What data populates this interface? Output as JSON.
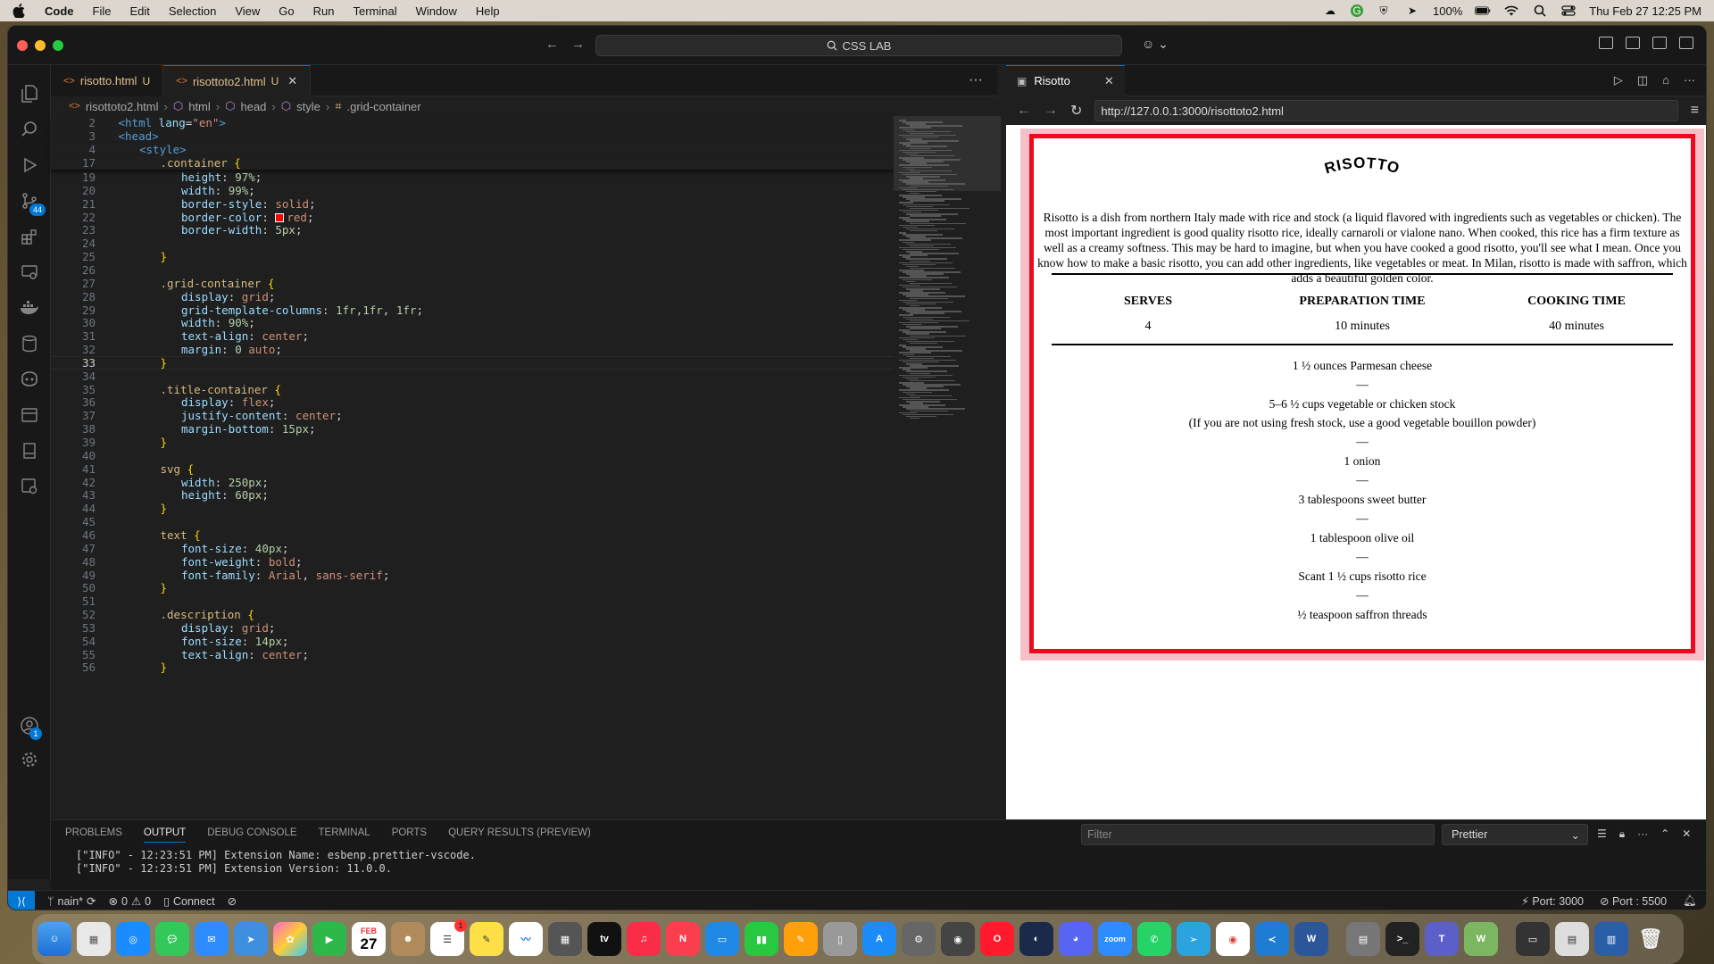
{
  "menubar": {
    "app": "Code",
    "items": [
      "File",
      "Edit",
      "Selection",
      "View",
      "Go",
      "Run",
      "Terminal",
      "Window",
      "Help"
    ],
    "battery": "100%",
    "datetime": "Thu Feb 27  12:25 PM"
  },
  "titlebar": {
    "search": "CSS LAB"
  },
  "activity_badges": {
    "source_control": "44",
    "accounts": "1"
  },
  "editor_tabs": [
    {
      "name": "risotto.html",
      "status": "U"
    },
    {
      "name": "risottoto2.html",
      "status": "U"
    }
  ],
  "breadcrumb": [
    "risottoto2.html",
    "html",
    "head",
    "style",
    ".grid-container"
  ],
  "code": {
    "sticky": [
      {
        "ln": "2",
        "indent": 1,
        "html": "<span class='c-tag'>&lt;html</span> <span class='c-attr'>lang</span>=<span class='c-str'>\"en\"</span><span class='c-tag'>&gt;</span>"
      },
      {
        "ln": "3",
        "indent": 1,
        "html": "<span class='c-tag'>&lt;head&gt;</span>"
      },
      {
        "ln": "4",
        "indent": 2,
        "html": "<span class='c-tag'>&lt;style&gt;</span>"
      },
      {
        "ln": "17",
        "indent": 3,
        "html": "<span class='c-sel'>.container</span> <span class='c-bracket'>{</span>"
      }
    ],
    "lines": [
      {
        "ln": "19",
        "indent": 4,
        "html": "<span class='c-prop'>height</span>: <span class='c-num'>97%</span>;"
      },
      {
        "ln": "20",
        "indent": 4,
        "html": "<span class='c-prop'>width</span>: <span class='c-num'>99%</span>;"
      },
      {
        "ln": "21",
        "indent": 4,
        "html": "<span class='c-prop'>border-style</span>: <span class='c-val'>solid</span>;"
      },
      {
        "ln": "22",
        "indent": 4,
        "html": "<span class='c-prop'>border-color</span>: <span class='swatch'></span><span class='c-val'>red</span>;"
      },
      {
        "ln": "23",
        "indent": 4,
        "html": "<span class='c-prop'>border-width</span>: <span class='c-num'>5px</span>;"
      },
      {
        "ln": "24",
        "indent": 0,
        "html": ""
      },
      {
        "ln": "25",
        "indent": 3,
        "html": "<span class='c-bracket'>}</span>"
      },
      {
        "ln": "26",
        "indent": 0,
        "html": ""
      },
      {
        "ln": "27",
        "indent": 3,
        "html": "<span class='c-sel'>.grid-container</span> <span class='c-bracket'>{</span>"
      },
      {
        "ln": "28",
        "indent": 4,
        "html": "<span class='c-prop'>display</span>: <span class='c-val'>grid</span>;"
      },
      {
        "ln": "29",
        "indent": 4,
        "html": "<span class='c-prop'>grid-template-columns</span>: <span class='c-num'>1fr</span>,<span class='c-num'>1fr</span>, <span class='c-num'>1fr</span>;"
      },
      {
        "ln": "30",
        "indent": 4,
        "html": "<span class='c-prop'>width</span>: <span class='c-num'>90%</span>;"
      },
      {
        "ln": "31",
        "indent": 4,
        "html": "<span class='c-prop'>text-align</span>: <span class='c-val'>center</span>;"
      },
      {
        "ln": "32",
        "indent": 4,
        "html": "<span class='c-prop'>margin</span>: <span class='c-num'>0</span> <span class='c-val'>auto</span>;"
      },
      {
        "ln": "33",
        "indent": 3,
        "html": "<span class='c-bracket'>}</span>",
        "current": true
      },
      {
        "ln": "34",
        "indent": 0,
        "html": ""
      },
      {
        "ln": "35",
        "indent": 3,
        "html": "<span class='c-sel'>.title-container</span> <span class='c-bracket'>{</span>"
      },
      {
        "ln": "36",
        "indent": 4,
        "html": "<span class='c-prop'>display</span>: <span class='c-val'>flex</span>;"
      },
      {
        "ln": "37",
        "indent": 4,
        "html": "<span class='c-prop'>justify-content</span>: <span class='c-val'>center</span>;"
      },
      {
        "ln": "38",
        "indent": 4,
        "html": "<span class='c-prop'>margin-bottom</span>: <span class='c-num'>15px</span>;"
      },
      {
        "ln": "39",
        "indent": 3,
        "html": "<span class='c-bracket'>}</span>"
      },
      {
        "ln": "40",
        "indent": 0,
        "html": ""
      },
      {
        "ln": "41",
        "indent": 3,
        "html": "<span class='c-sel'>svg</span> <span class='c-bracket'>{</span>"
      },
      {
        "ln": "42",
        "indent": 4,
        "html": "<span class='c-prop'>width</span>: <span class='c-num'>250px</span>;"
      },
      {
        "ln": "43",
        "indent": 4,
        "html": "<span class='c-prop'>height</span>: <span class='c-num'>60px</span>;"
      },
      {
        "ln": "44",
        "indent": 3,
        "html": "<span class='c-bracket'>}</span>"
      },
      {
        "ln": "45",
        "indent": 0,
        "html": ""
      },
      {
        "ln": "46",
        "indent": 3,
        "html": "<span class='c-sel'>text</span> <span class='c-bracket'>{</span>"
      },
      {
        "ln": "47",
        "indent": 4,
        "html": "<span class='c-prop'>font-size</span>: <span class='c-num'>40px</span>;"
      },
      {
        "ln": "48",
        "indent": 4,
        "html": "<span class='c-prop'>font-weight</span>: <span class='c-val'>bold</span>;"
      },
      {
        "ln": "49",
        "indent": 4,
        "html": "<span class='c-prop'>font-family</span>: <span class='c-val'>Arial</span>, <span class='c-val'>sans-serif</span>;"
      },
      {
        "ln": "50",
        "indent": 3,
        "html": "<span class='c-bracket'>}</span>"
      },
      {
        "ln": "51",
        "indent": 0,
        "html": ""
      },
      {
        "ln": "52",
        "indent": 3,
        "html": "<span class='c-sel'>.description</span> <span class='c-bracket'>{</span>"
      },
      {
        "ln": "53",
        "indent": 4,
        "html": "<span class='c-prop'>display</span>: <span class='c-val'>grid</span>;"
      },
      {
        "ln": "54",
        "indent": 4,
        "html": "<span class='c-prop'>font-size</span>: <span class='c-num'>14px</span>;"
      },
      {
        "ln": "55",
        "indent": 4,
        "html": "<span class='c-prop'>text-align</span>: <span class='c-val'>center</span>;"
      },
      {
        "ln": "56",
        "indent": 3,
        "html": "<span class='c-bracket'>}</span>"
      }
    ]
  },
  "browser": {
    "tab_title": "Risotto",
    "url": "http://127.0.0.1:3000/risottoto2.html"
  },
  "recipe": {
    "title": "RISOTTO",
    "description": "Risotto is a dish from northern Italy made with rice and stock (a liquid flavored with ingredients such as vegetables or chicken). The most important ingredient is good quality risotto rice, ideally carnaroli or vialone nano. When cooked, this rice has a firm texture as well as a creamy softness. This may be hard to imagine, but when you have cooked a good risotto, you'll see what I mean. Once you know how to make a basic risotto, you can add other ingredients, like vegetables or meat. In Milan, risotto is made with saffron, which adds a beautiful golden color.",
    "stats": [
      {
        "label": "SERVES",
        "value": "4"
      },
      {
        "label": "PREPARATION TIME",
        "value": "10 minutes"
      },
      {
        "label": "COOKING TIME",
        "value": "40 minutes"
      }
    ],
    "ingredients": [
      [
        "1 ½ ounces Parmesan cheese"
      ],
      [
        "5–6 ½ cups vegetable or chicken stock",
        "(If you are not using fresh stock, use a good vegetable bouillon powder)"
      ],
      [
        "1 onion"
      ],
      [
        "3 tablespoons sweet butter"
      ],
      [
        "1 tablespoon olive oil"
      ],
      [
        "Scant 1 ½ cups risotto rice"
      ],
      [
        "½ teaspoon saffron threads"
      ]
    ],
    "dash": "—",
    "border_color": "#ee0a1c"
  },
  "panel": {
    "tabs": [
      "PROBLEMS",
      "OUTPUT",
      "DEBUG CONSOLE",
      "TERMINAL",
      "PORTS",
      "QUERY RESULTS (PREVIEW)"
    ],
    "filter_placeholder": "Filter",
    "channel": "Prettier",
    "output": [
      "[\"INFO\" - 12:23:51 PM] Extension Name: esbenp.prettier-vscode.",
      "[\"INFO\" - 12:23:51 PM] Extension Version: 11.0.0."
    ]
  },
  "statusbar": {
    "branch": "nain*",
    "errors": "0",
    "warnings": "0",
    "connect": "Connect",
    "port1": "Port: 3000",
    "port2": "Port : 5500"
  },
  "dock": {
    "calendar_month": "FEB",
    "calendar_day": "27",
    "reminders_badge": "1",
    "appletv_label": "tv",
    "zoom_label": "zoom"
  }
}
